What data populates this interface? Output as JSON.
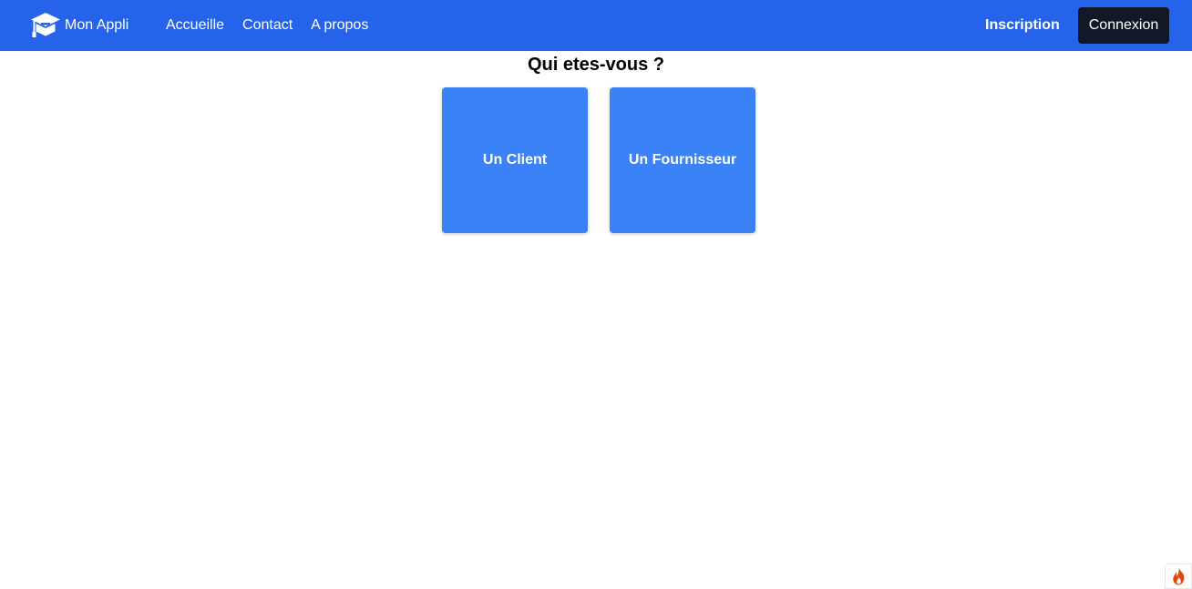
{
  "navbar": {
    "brand": {
      "logo_icon": "graduation-cap-icon",
      "name": "Mon Appli"
    },
    "links": [
      {
        "label": "Accueille"
      },
      {
        "label": "Contact"
      },
      {
        "label": "A propos"
      }
    ],
    "signup_label": "Inscription",
    "login_label": "Connexion",
    "colors": {
      "background": "#2563eb",
      "login_background": "#111827",
      "text": "#ffffff"
    }
  },
  "main": {
    "heading": "Qui etes-vous ?",
    "choices": [
      {
        "label": "Un Client"
      },
      {
        "label": "Un Fournisseur"
      }
    ],
    "choice_color": "#3b82f6"
  },
  "debug_toolbar": {
    "icon": "flame-icon",
    "color": "#dd4814"
  }
}
